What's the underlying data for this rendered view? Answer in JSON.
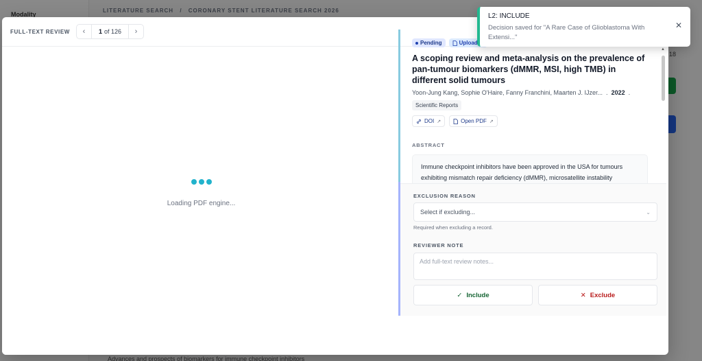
{
  "backdrop": {
    "breadcrumb_1": "LITERATURE SEARCH",
    "breadcrumb_sep": "/",
    "breadcrumb_2": "CORONARY STENT LITERATURE SEARCH 2026",
    "sidebar_title": "Modality",
    "bottom_text": "Advances and prospects of biomarkers for immune checkpoint inhibitors",
    "side_num": "18"
  },
  "modal": {
    "header_label": "FULL-TEXT REVIEW",
    "pager": {
      "prev_icon": "‹",
      "current": "1",
      "of_label": "of 126",
      "next_icon": "›"
    }
  },
  "viewer": {
    "loading_text": "Loading PDF engine..."
  },
  "record": {
    "status_pending": "Pending",
    "status_uploaded": "Uploaded",
    "title": "A scoping review and meta-analysis on the prevalence of pan-tumour biomarkers (dMMR, MSI, high TMB) in different solid tumours",
    "authors": "Yoon-Jung Kang, Sophie O'Haire, Fanny Franchini, Maarten J. IJzer...",
    "sep": ".",
    "year": "2022",
    "sep2": ".",
    "journal": "Scientific Reports",
    "doi_label": "DOI",
    "pdf_label": "Open PDF",
    "abstract_heading": "ABSTRACT",
    "abstract_text": "Immune checkpoint inhibitors have been approved in the USA for tumours exhibiting mismatch repair deficiency (dMMR), microsatellite instability"
  },
  "decision": {
    "exclusion_heading": "EXCLUSION REASON",
    "exclusion_placeholder": "Select if excluding...",
    "exclusion_hint": "Required when excluding a record.",
    "note_heading": "REVIEWER NOTE",
    "note_placeholder": "Add full-text review notes...",
    "include_label": "Include",
    "exclude_label": "Exclude"
  },
  "toast": {
    "title": "L2: INCLUDE",
    "message": "Decision saved for \"A Rare Case of Glioblastoma With Extensi...\""
  },
  "colors": {
    "accent_teal": "#22b3cc",
    "toast_accent": "#22b890",
    "include_green": "#166534",
    "exclude_red": "#b91c1c"
  }
}
